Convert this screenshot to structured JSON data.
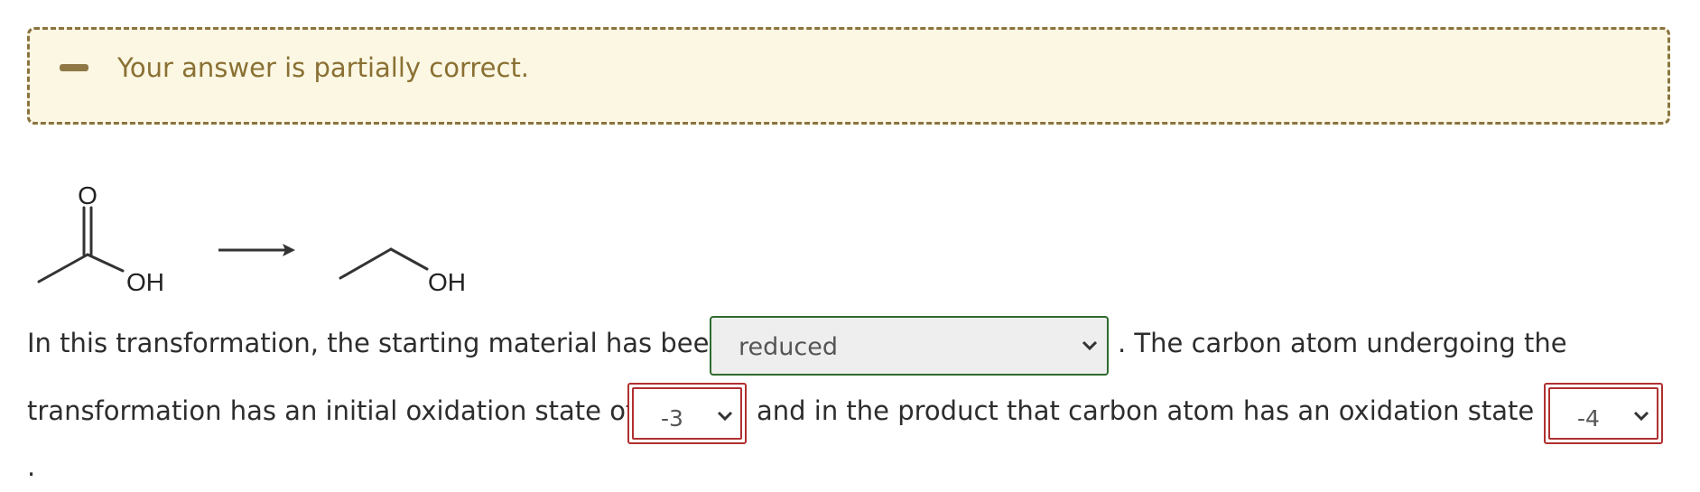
{
  "feedback": {
    "icon": "minus-icon",
    "message": "Your answer is partially correct.",
    "colors": {
      "background": "#fbf7e3",
      "border": "#8a7340",
      "text": "#8a7033"
    }
  },
  "reaction": {
    "starting_material_label": "OH",
    "starting_material_carbonyl_label": "O",
    "product_label": "OH",
    "arrow": "reaction-arrow"
  },
  "question": {
    "sentence_part1": "In this transformation, the starting material has been",
    "oxidation_select_value": "reduced",
    "sentence_part2": ". The carbon atom undergoing the",
    "sentence_part3": "transformation has an initial oxidation state of",
    "initial_state_value": "-3",
    "sentence_part4": "and in the product that carbon atom has an oxidation state of",
    "final_state_value": "-4",
    "sentence_end": "."
  }
}
